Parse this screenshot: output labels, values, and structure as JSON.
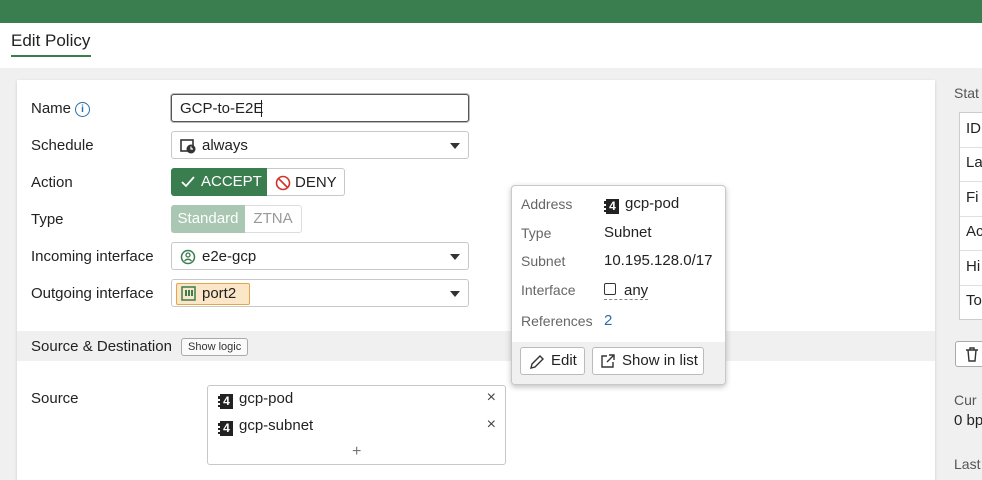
{
  "page": {
    "title": "Edit Policy"
  },
  "form": {
    "name": {
      "label": "Name",
      "value": "GCP-to-E2E"
    },
    "schedule": {
      "label": "Schedule",
      "value": "always"
    },
    "action": {
      "label": "Action",
      "accept": "ACCEPT",
      "deny": "DENY",
      "selected": "ACCEPT"
    },
    "type": {
      "label": "Type",
      "standard": "Standard",
      "ztna": "ZTNA",
      "selected": "Standard"
    },
    "incoming": {
      "label": "Incoming interface",
      "value": "e2e-gcp"
    },
    "outgoing": {
      "label": "Outgoing interface",
      "value": "port2"
    }
  },
  "section": {
    "title": "Source & Destination",
    "show_logic": "Show logic"
  },
  "source": {
    "label": "Source",
    "items": [
      {
        "name": "gcp-pod"
      },
      {
        "name": "gcp-subnet"
      }
    ],
    "add": "+",
    "remove": "×"
  },
  "popup": {
    "address": {
      "label": "Address",
      "value": "gcp-pod"
    },
    "type": {
      "label": "Type",
      "value": "Subnet"
    },
    "subnet": {
      "label": "Subnet",
      "value": "10.195.128.0/17"
    },
    "interface": {
      "label": "Interface",
      "value": "any"
    },
    "references": {
      "label": "References",
      "value": "2"
    },
    "edit_button": "Edit",
    "show_in_list_button": "Show in list"
  },
  "right_panel": {
    "heading": "Stat",
    "rows": [
      "ID",
      "La",
      "Fi",
      "Ac",
      "Hi",
      "To"
    ],
    "current_label": "Cur",
    "current_value": "0 bp",
    "last_label": "Last"
  },
  "colors": {
    "brand": "#3a7d4f",
    "link": "#2a6ea6"
  },
  "icons": [
    "info-icon",
    "clock-schedule-icon",
    "check-icon",
    "deny-icon",
    "wan-interface-icon",
    "port-icon",
    "dropdown-caret-icon",
    "address-icon",
    "close-icon",
    "plus-icon",
    "pencil-icon",
    "external-link-icon",
    "trash-icon",
    "checkbox-icon"
  ]
}
